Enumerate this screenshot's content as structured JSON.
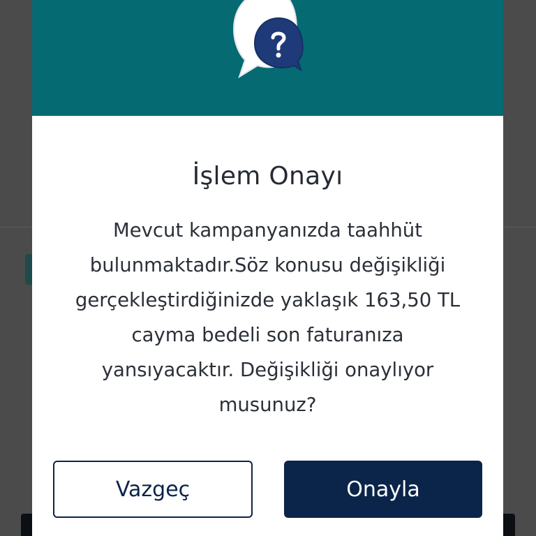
{
  "dialog": {
    "title": "İşlem Onayı",
    "message": "Mevcut kampanyanızda taahhüt bulunmaktadır.Söz konusu değişikliği gerçekleştirdiğinizde yaklaşık 163,50 TL cayma bedeli son faturanıza yansıyacaktır. Değişikliği onaylıyor musunuz?",
    "icon": "question-speech-bubble-icon",
    "cancel_label": "Vazgeç",
    "confirm_label": "Onayla"
  },
  "colors": {
    "header": "#056a72",
    "primary": "#0b2449",
    "overlay": "#4a4a4a",
    "text": "#262b33"
  }
}
